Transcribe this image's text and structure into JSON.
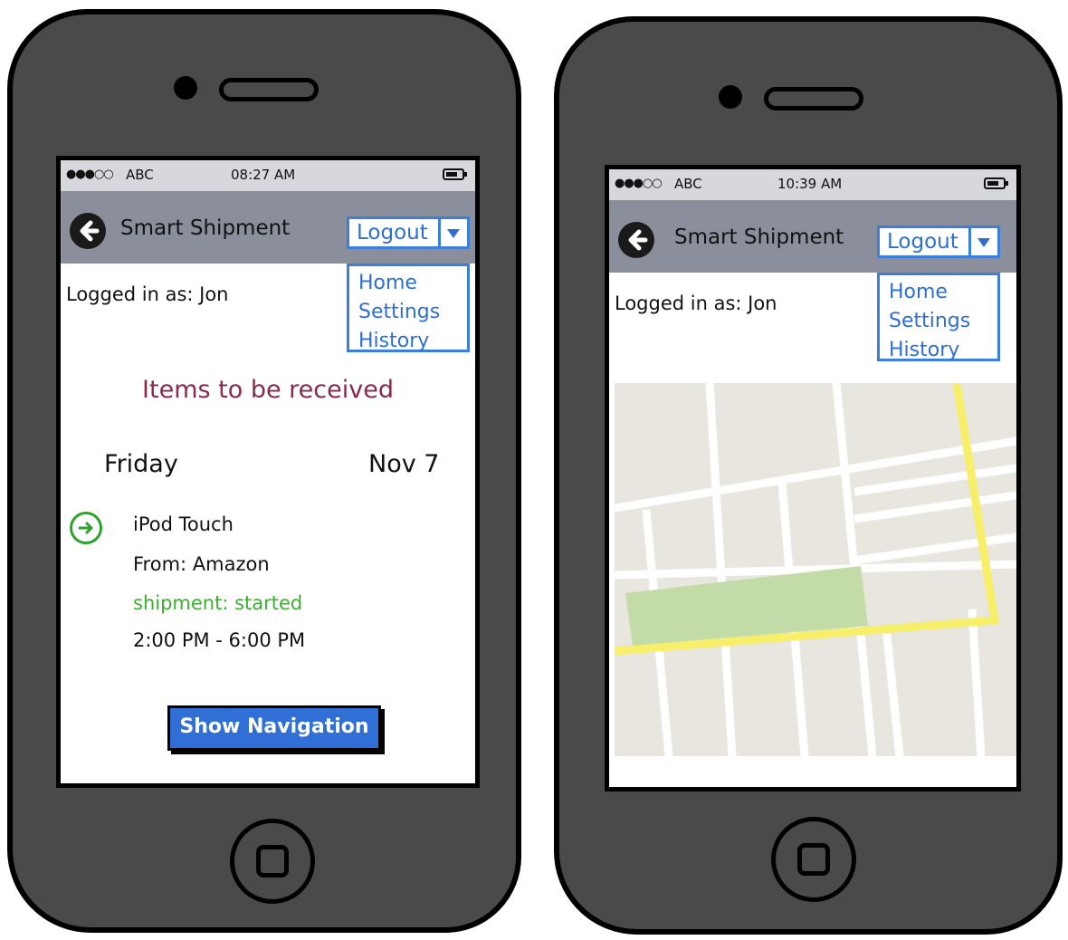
{
  "status": {
    "signal": "●●●○○",
    "carrier": "ABC"
  },
  "left": {
    "status_time": "08:27 AM",
    "app_title": "Smart Shipment",
    "logout_label": "Logout",
    "menu": [
      "Home",
      "Settings",
      "History"
    ],
    "logged_in": "Logged in as: Jon",
    "heading": "Items to be received",
    "day": "Friday",
    "date": "Nov 7",
    "item": {
      "name": "iPod Touch",
      "from": "From: Amazon",
      "status": "shipment: started",
      "window": "2:00 PM - 6:00 PM"
    },
    "button_label": "Show Navigation"
  },
  "right": {
    "status_time": "10:39 AM",
    "app_title": "Smart Shipment",
    "logout_label": "Logout",
    "menu": [
      "Home",
      "Settings",
      "History"
    ],
    "logged_in": "Logged in as: Jon"
  },
  "colors": {
    "phone_body": "#4a4a4a",
    "nav_bar": "#8a8f9b",
    "accent_blue": "#3b7fd9",
    "heading": "#8a2a4a",
    "status_green": "#3fae35",
    "map_bg": "#e8e6df",
    "map_road": "#ffffff",
    "map_highway": "#f7ee6a",
    "map_park": "#c2dba7"
  },
  "icons": {
    "back": "back-arrow-circle-icon",
    "dropdown": "caret-down-icon",
    "item": "arrow-right-circle-icon",
    "battery": "battery-icon"
  }
}
